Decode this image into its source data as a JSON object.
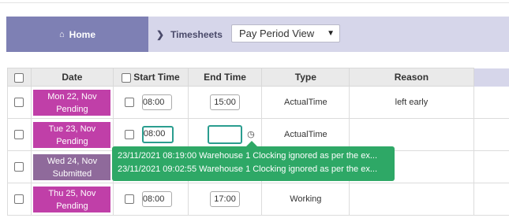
{
  "breadcrumb": {
    "home_label": "Home",
    "current_label": "Timesheets",
    "view_select": {
      "value": "Pay Period View"
    }
  },
  "table": {
    "headers": {
      "date": "Date",
      "start_time": "Start Time",
      "end_time": "End Time",
      "type": "Type",
      "reason": "Reason"
    },
    "rows": [
      {
        "date_line1": "Mon 22, Nov",
        "status": "Pending",
        "start": "08:00",
        "end": "15:00",
        "type": "ActualTime",
        "reason": "left early"
      },
      {
        "date_line1": "Tue 23, Nov",
        "status": "Pending",
        "start": "08:00",
        "end": "",
        "type": "ActualTime",
        "reason": ""
      },
      {
        "date_line1": "Wed 24, Nov",
        "status": "Submitted",
        "start": "",
        "end": "",
        "type": "",
        "reason": ""
      },
      {
        "date_line1": "Thu 25, Nov",
        "status": "Pending",
        "start": "08:00",
        "end": "17:00",
        "type": "Working",
        "reason": ""
      }
    ]
  },
  "tooltip": {
    "lines": [
      "23/11/2021 08:19:00 Warehouse 1 Clocking ignored as per the ex...",
      "23/11/2021 09:02:55 Warehouse 1 Clocking ignored as per the ex..."
    ]
  },
  "colors": {
    "pending": "#c03fa8",
    "submitted": "#8f6a9b",
    "tooltip": "#2ea866",
    "home": "#7e80b4",
    "crumb_bar": "#d6d6ea"
  },
  "icons": {
    "home": "home-icon",
    "chevron": "chevron-right-icon",
    "clock": "clock-icon"
  }
}
